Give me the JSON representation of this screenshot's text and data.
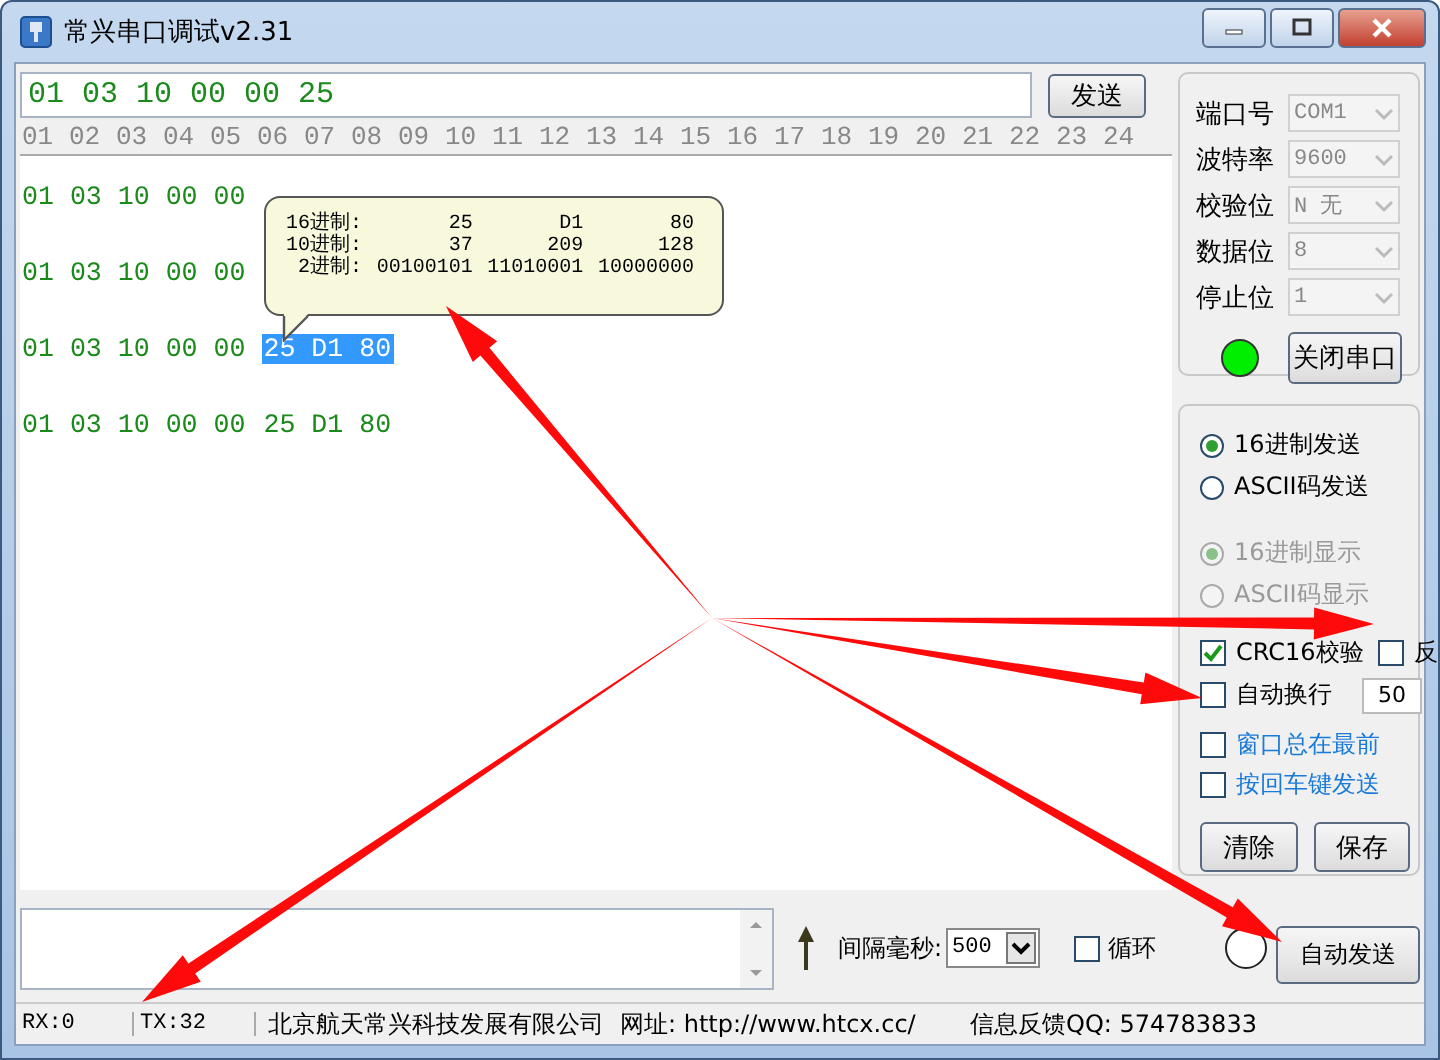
{
  "window": {
    "title": "常兴串口调试v2.31"
  },
  "send_field": {
    "value": "01 03 10 00 00 25"
  },
  "send_button": "发送",
  "ruler": [
    "01",
    "02",
    "03",
    "04",
    "05",
    "06",
    "07",
    "08",
    "09",
    "10",
    "11",
    "12",
    "13",
    "14",
    "15",
    "16",
    "17",
    "18",
    "19",
    "20",
    "21",
    "22",
    "23",
    "24"
  ],
  "received": [
    {
      "prefix": "01 03 10 00 00"
    },
    {
      "prefix": "01 03 10 00 00"
    },
    {
      "prefix": "01 03 10 00 00",
      "tail": "25 D1 80",
      "selected": true
    },
    {
      "prefix": "01 03 10 00 00",
      "tail": "25 D1 80",
      "selected": false
    }
  ],
  "tooltip": {
    "rows": [
      {
        "label": "16进制:",
        "values": [
          "25",
          "D1",
          "80"
        ]
      },
      {
        "label": "10进制:",
        "values": [
          "37",
          "209",
          "128"
        ]
      },
      {
        "label": "2进制:",
        "values": [
          "00100101",
          "11010001",
          "10000000"
        ]
      }
    ]
  },
  "port_settings": [
    {
      "label": "端口号",
      "value": "COM1"
    },
    {
      "label": "波特率",
      "value": "9600"
    },
    {
      "label": "校验位",
      "value": "N 无"
    },
    {
      "label": "数据位",
      "value": "8"
    },
    {
      "label": "停止位",
      "value": "1"
    }
  ],
  "port_open": true,
  "port_button": "关闭串口",
  "send_mode": [
    {
      "label": "16进制发送",
      "selected": true
    },
    {
      "label": "ASCII码发送",
      "selected": false
    }
  ],
  "display_mode": [
    {
      "label": "16进制显示",
      "selected": true,
      "disabled": true
    },
    {
      "label": "ASCII码显示",
      "selected": false,
      "disabled": true
    }
  ],
  "crc": {
    "label": "CRC16校验",
    "checked": true
  },
  "reverse": {
    "label": "反",
    "checked": false
  },
  "auto_wrap": {
    "label": "自动换行",
    "checked": false,
    "value": "50"
  },
  "window_options": [
    {
      "label": "窗口总在最前",
      "checked": false
    },
    {
      "label": "按回车键发送",
      "checked": false
    }
  ],
  "clear_button": "清除",
  "save_button": "保存",
  "interval": {
    "label": "间隔毫秒:",
    "value": "500"
  },
  "loop": {
    "label": "循环",
    "checked": false
  },
  "auto_send": {
    "label": "自动发送",
    "active": false
  },
  "status_bar": [
    "RX:0",
    "TX:32",
    "北京航天常兴科技发展有限公司",
    "网址: http://www.htcx.cc/",
    "信息反馈QQ: 574783833"
  ]
}
